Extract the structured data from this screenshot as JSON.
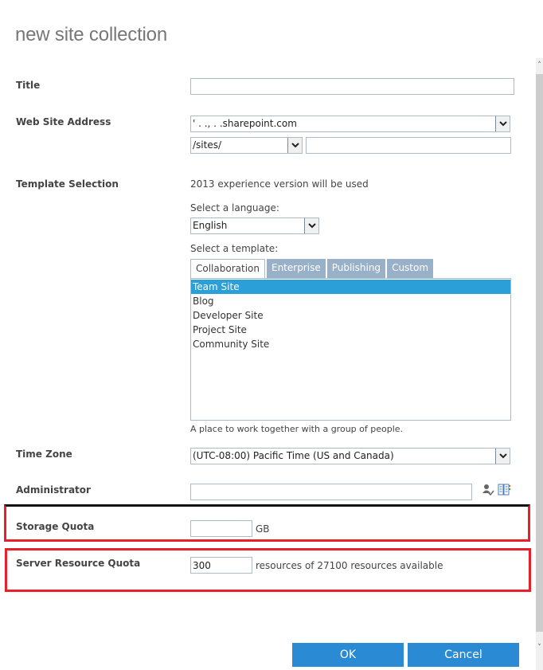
{
  "dialog": {
    "title": "new site collection"
  },
  "fields": {
    "title": {
      "label": "Title",
      "value": ""
    },
    "web_site_address": {
      "label": "Web Site Address",
      "domain_value": "'   .  .,    .          .sharepoint.com",
      "path_value": "/sites/",
      "url_value": ""
    },
    "template_selection": {
      "label": "Template Selection",
      "experience_note": "2013 experience version will be used",
      "language_label": "Select a language:",
      "language_value": "English",
      "template_label": "Select a template:",
      "tabs": [
        {
          "label": "Collaboration",
          "active": true
        },
        {
          "label": "Enterprise",
          "active": false
        },
        {
          "label": "Publishing",
          "active": false
        },
        {
          "label": "Custom",
          "active": false
        }
      ],
      "templates": [
        {
          "label": "Team Site",
          "selected": true
        },
        {
          "label": "Blog",
          "selected": false
        },
        {
          "label": "Developer Site",
          "selected": false
        },
        {
          "label": "Project Site",
          "selected": false
        },
        {
          "label": "Community Site",
          "selected": false
        }
      ],
      "description": "A place to work together with a group of people."
    },
    "time_zone": {
      "label": "Time Zone",
      "value": "(UTC-08:00) Pacific Time (US and Canada)"
    },
    "administrator": {
      "label": "Administrator",
      "value": ""
    },
    "storage_quota": {
      "label": "Storage Quota",
      "value": "",
      "unit": "GB"
    },
    "server_resource_quota": {
      "label": "Server Resource Quota",
      "value": "300",
      "suffix": "resources of 27100 resources available"
    }
  },
  "buttons": {
    "ok": "OK",
    "cancel": "Cancel"
  },
  "colors": {
    "accent": "#2a8ad4",
    "selection": "#2a9fd8",
    "highlight_box": "#e8202a",
    "inactive_tab": "#98b1c8"
  }
}
